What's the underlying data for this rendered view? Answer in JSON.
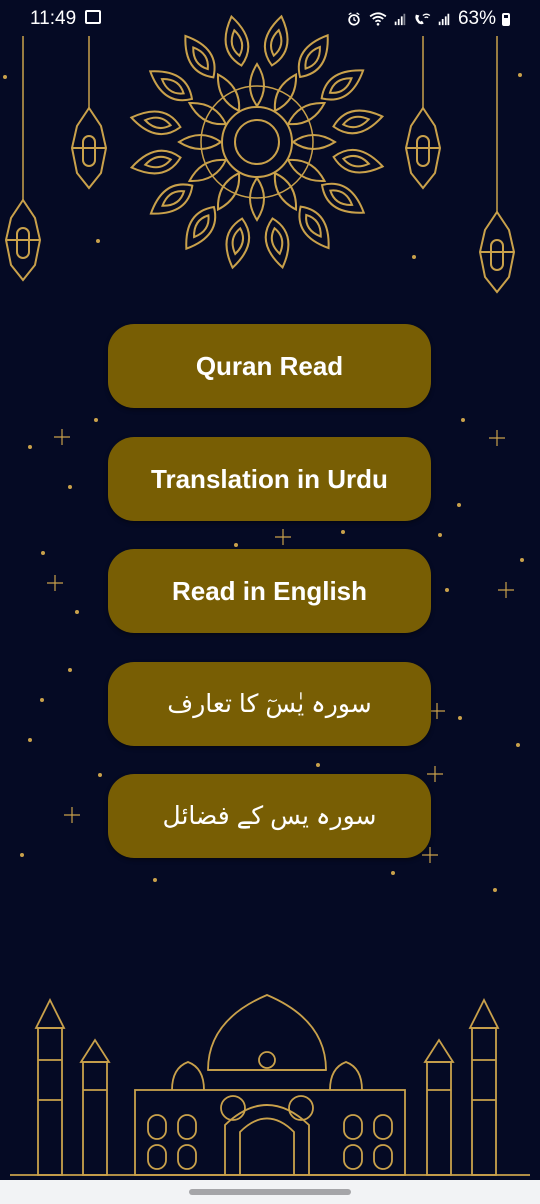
{
  "status_bar": {
    "time": "11:49",
    "battery": "63%"
  },
  "icons": {
    "gallery": "image-icon",
    "alarm": "alarm-icon",
    "wifi": "wifi-icon",
    "signal1": "signal-icon",
    "call": "wifi-calling-icon",
    "signal2": "signal-icon",
    "battery": "battery-icon"
  },
  "menu": {
    "items": [
      {
        "label": "Quran Read"
      },
      {
        "label": "Translation in Urdu"
      },
      {
        "label": "Read in English"
      },
      {
        "label": "سورہ یٰسٓ کا تعارف"
      },
      {
        "label": "سورہ یس کے فضائل"
      }
    ]
  },
  "colors": {
    "background": "#050a24",
    "button": "#785e04",
    "gold": "#c9a14b"
  }
}
